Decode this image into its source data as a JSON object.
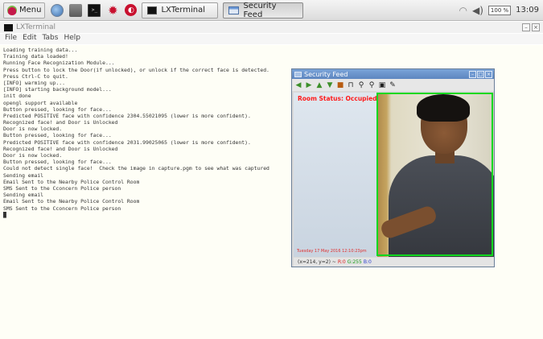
{
  "taskbar": {
    "menu_label": "Menu",
    "launchers": [
      "globe-icon",
      "files-icon",
      "terminal-icon",
      "gear-icon",
      "shield-icon"
    ],
    "tasks": [
      {
        "label": "LXTerminal",
        "icon": "terminal-icon",
        "active": false
      },
      {
        "label": "Security Feed",
        "icon": "window-icon",
        "active": true
      }
    ],
    "cpu_label": "100 %",
    "clock": "13:09"
  },
  "terminal": {
    "title": "LXTerminal",
    "menu": [
      "File",
      "Edit",
      "Tabs",
      "Help"
    ],
    "lines": [
      "Loading training data...",
      "Training data loaded!",
      "Running Face Recognization Module...",
      "Press button to lock the Door(if unlocked), or unlock if the correct face is detected.",
      "Press Ctrl-C to quit.",
      "[INFO] warming up...",
      "[INFO] starting background model...",
      "init done",
      "opengl support available",
      "Button pressed, looking for face...",
      "Predicted POSITIVE face with confidence 2304.55021095 (lower is more confident).",
      "Recognized face! and Door is Unlocked",
      "Door is now locked.",
      "Button pressed, looking for face...",
      "Predicted POSITIVE face with confidence 2031.99025065 (lower is more confident).",
      "Recognized face! and Door is Unlocked",
      "Door is now locked.",
      "Button pressed, looking for face...",
      "Could not detect single face!  Check the image in capture.pgm to see what was captured",
      "Sending email",
      "Email Sent to the Nearby Police Control Room",
      "SMS Sent to the Cconcern Police person",
      "Sending email",
      "Email Sent to the Nearby Police Control Room",
      "SMS Sent to the Cconcern Police person",
      "█"
    ]
  },
  "feed": {
    "title": "Security Feed",
    "toolbar": [
      "arrow-left-icon",
      "arrow-right-icon",
      "arrow-up-icon",
      "arrow-down-icon",
      "save-icon",
      "print-icon",
      "zoom-in-icon",
      "zoom-out-icon",
      "floppy-icon",
      "pin-icon"
    ],
    "room_status": "Room Status: Occupied",
    "timestamp": "Tuesday 17 May 2016 12:10:23pm",
    "status_coords": "(x=214, y=2) ~",
    "status_r": "R:0",
    "status_g": "G:255",
    "status_b": "B:0"
  }
}
